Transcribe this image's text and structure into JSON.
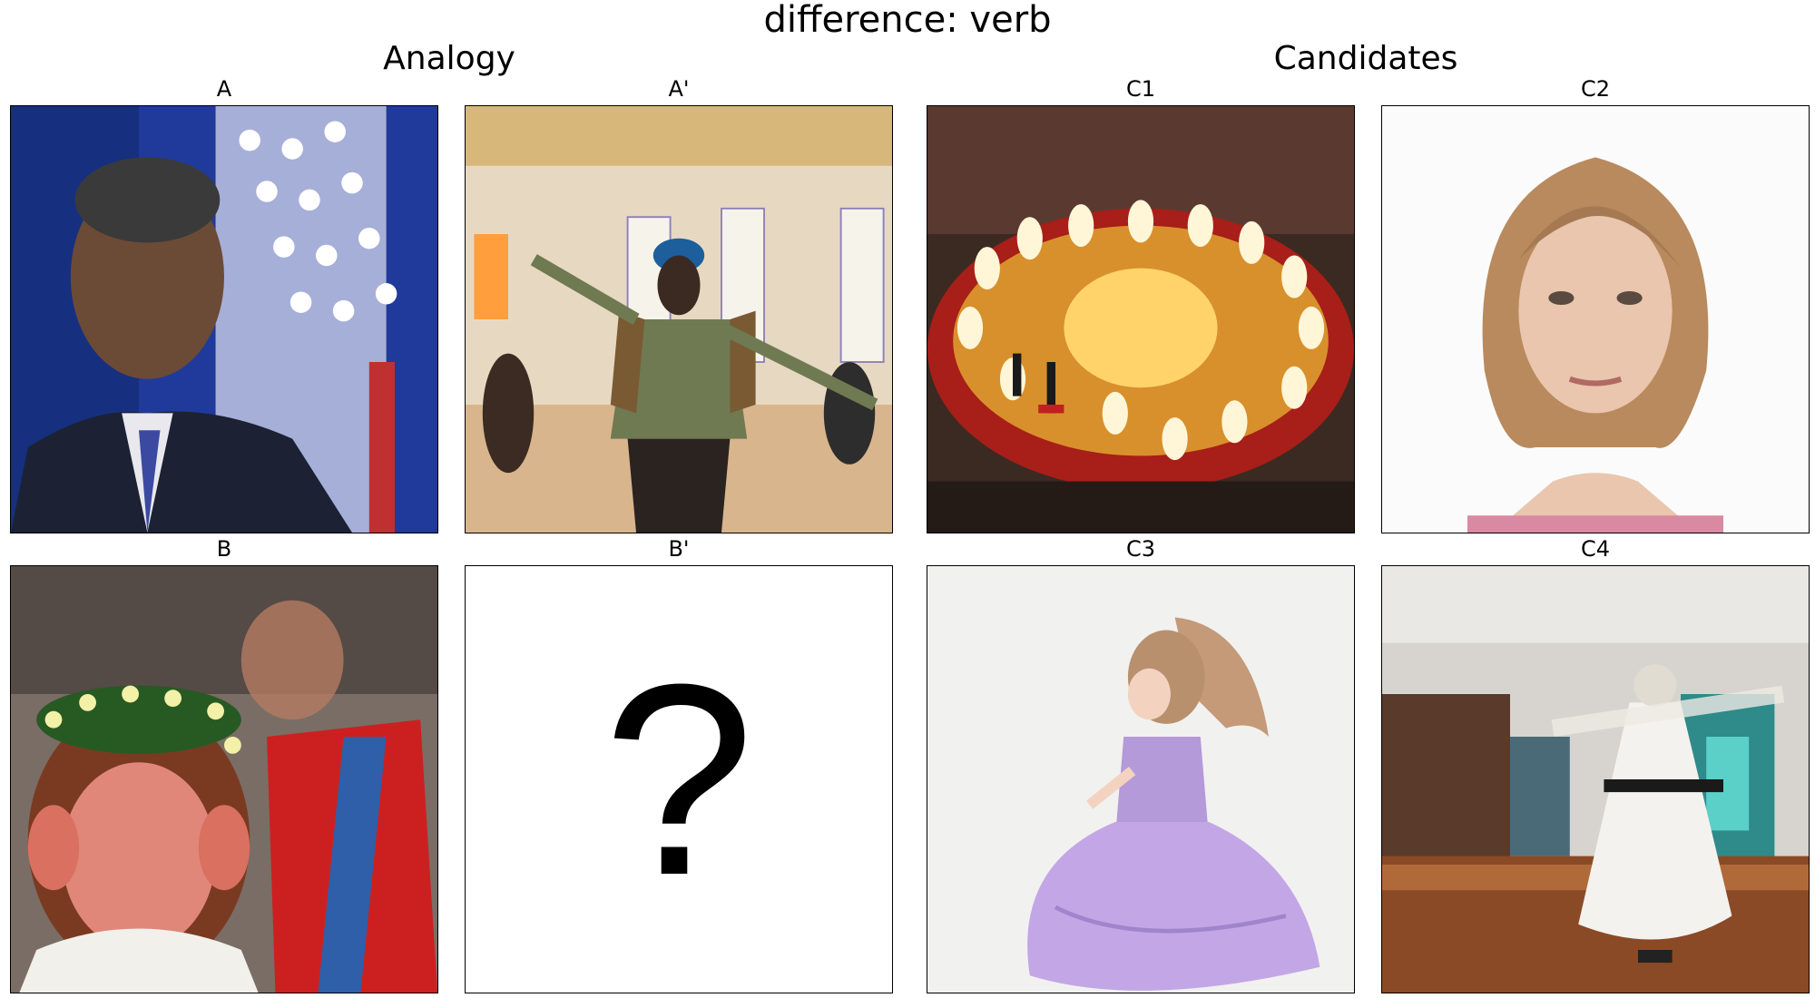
{
  "suptitle": "difference: verb",
  "sections": {
    "analogy": "Analogy",
    "candidates": "Candidates"
  },
  "panels": {
    "A": "A",
    "A_prime": "A'",
    "B": "B",
    "B_prime": "B'",
    "C1": "C1",
    "C2": "C2",
    "C3": "C3",
    "C4": "C4"
  },
  "unknown_symbol": "?"
}
